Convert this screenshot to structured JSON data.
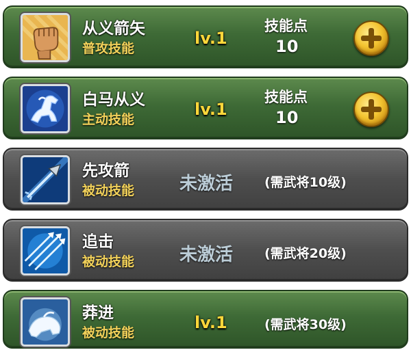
{
  "skills": [
    {
      "name": "从义箭矢",
      "type": "普攻技能",
      "level": "lv.1",
      "points_label": "技能点",
      "points": "10",
      "icon": "fist-icon"
    },
    {
      "name": "白马从义",
      "type": "主动技能",
      "level": "lv.1",
      "points_label": "技能点",
      "points": "10",
      "icon": "white-horse-icon"
    },
    {
      "name": "先攻箭",
      "type": "被动技能",
      "status": "未激活",
      "requirement": "(需武将10级)",
      "icon": "arrow-strike-icon"
    },
    {
      "name": "追击",
      "type": "被动技能",
      "status": "未激活",
      "requirement": "(需武将20级)",
      "icon": "volley-arrows-icon"
    },
    {
      "name": "莽进",
      "type": "被动技能",
      "level": "lv.1",
      "requirement": "(需武将30级)",
      "icon": "charging-beast-icon"
    }
  ],
  "colors": {
    "active_row": "#3e6a36",
    "locked_row": "#4e4e4e",
    "level_text": "#ffd73a",
    "type_text": "#f2d15a"
  }
}
